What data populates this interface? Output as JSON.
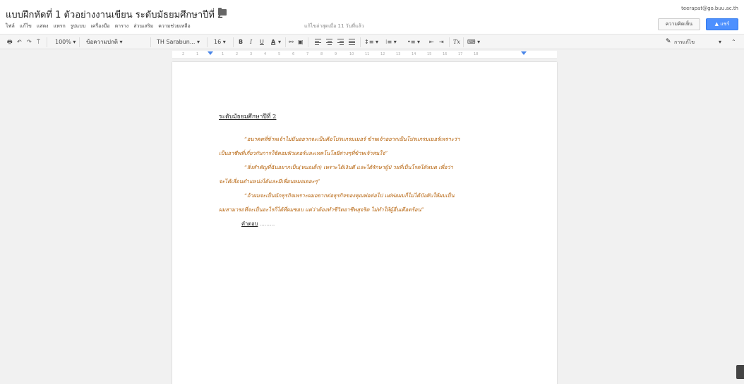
{
  "header": {
    "doc_title": "แบบฝึกหัดที่ 1 ตัวอย่างงานเขียน ระดับมัธยมศึกษาปีที่ 2",
    "star_glyph": "☆",
    "last_edit": "แก้ไขล่าสุดเมื่อ 11 วันที่แล้ว",
    "user_email": "teerapat@go.buu.ac.th",
    "comments_label": "ความคิดเห็น",
    "share_label": "แชร์",
    "share_color": "#4d90fe"
  },
  "menu": {
    "items": [
      "ไฟล์",
      "แก้ไข",
      "แสดง",
      "แทรก",
      "รูปแบบ",
      "เครื่องมือ",
      "ตาราง",
      "ส่วนเสริม",
      "ความช่วยเหลือ"
    ]
  },
  "toolbar": {
    "print": "🖶",
    "undo": "↶",
    "redo": "↷",
    "paint_format": "⍑",
    "zoom": "100%",
    "style": "ข้อความปกติ",
    "font": "TH Sarabun...",
    "font_size": "16",
    "bold": "B",
    "italic": "I",
    "underline": "U",
    "text_color": "A",
    "text_color_value": "#000000",
    "link": "⚯",
    "comment": "▣",
    "line_spacing": "↕≡",
    "numbered_list": "⁝≡",
    "bulleted_list": "•≡",
    "decrease_indent": "⇤",
    "increase_indent": "⇥",
    "clear_format": "Tx",
    "input_tools": "⌨",
    "caret": "▾",
    "edit_mode": "การแก้ไข",
    "pencil": "✎",
    "collapse": "⌃"
  },
  "ruler": {
    "ticks": [
      "2",
      "1",
      "1",
      "2",
      "3",
      "4",
      "5",
      "6",
      "7",
      "8",
      "9",
      "10",
      "11",
      "12",
      "13",
      "14",
      "15",
      "16",
      "17",
      "18"
    ]
  },
  "document": {
    "heading": "ระดับมัธยมศึกษาปีที่ 2",
    "text_color": "#b45f06",
    "paragraphs": [
      {
        "line1": "“อนาคตที่ข้าพเจ้าไม่มีนอยากจะเป็นคือโปรแกรมเมอร์ ข้าพเจ้าอยากเป็นโปรแกรมเมอร์เพราะว่า",
        "line2": "เป็นอาชีพที่เกี่ยวกับการใช้คอมพิวเตอร์และเทคโนโลยีต่างๆที่ข้าพเจ้าสนใจ”"
      },
      {
        "line1": "“สิ่งสำคัญที่ฉันอยากเป็น(หมอเด็ก) เพราะได้เงินดี และได้รักษาผู้ป่ วยที่เป็นโรคได้หมด เพื่อว่า",
        "line2": "จะได้เลื่อนตำแหน่งได้และมีเพื่อนหมอเยอะๆ”"
      },
      {
        "line1": "“ถ้าผมจะเป็นนักธุรกิจเพราะผมอยากต่อธุรกิจของคุณพ่อต่อไป แต่พ่อผมก็ไม่ได้บังคับให้ผมเป็น",
        "line2": "ผมสามารถที่จะเป็นอะไรก็ได้ที่ผมชอบ แต่ว่าต้องทำชีวิตอาชีพสุจริต ไม่ทำให้ผู้อื่นเดือดร้อน”"
      }
    ],
    "answer_label": "คำตอบ",
    "answer_dots": "........."
  }
}
